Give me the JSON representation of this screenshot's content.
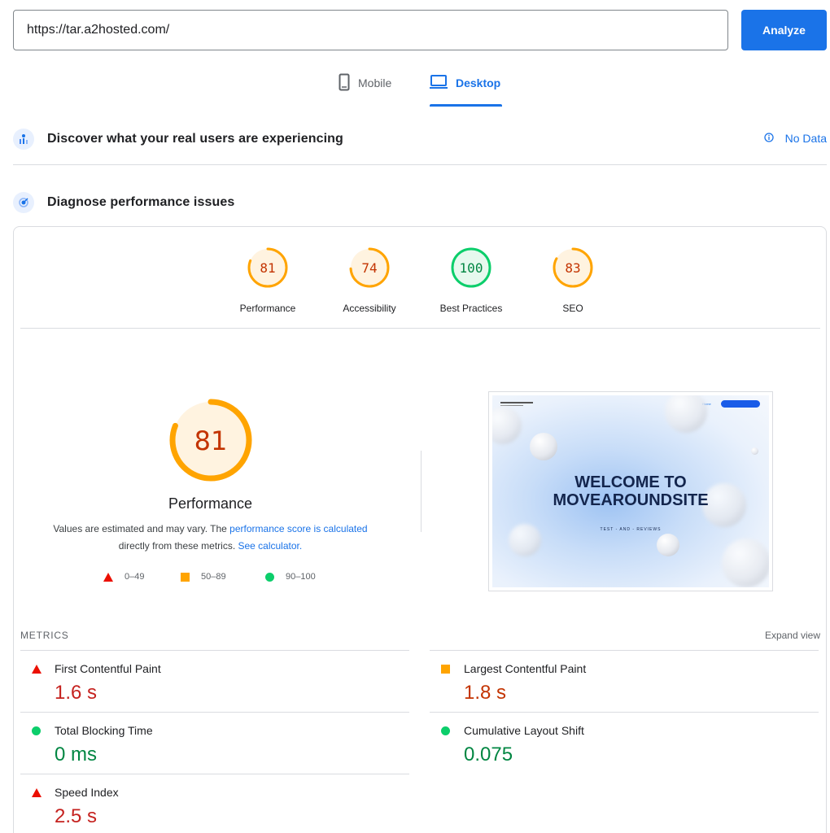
{
  "search": {
    "url_value": "https://tar.a2hosted.com/",
    "analyze_label": "Analyze"
  },
  "tabs": [
    {
      "label": "Mobile",
      "icon": "smartphone-icon",
      "active": false
    },
    {
      "label": "Desktop",
      "icon": "laptop-icon",
      "active": true
    }
  ],
  "field_data": {
    "title": "Discover what your real users are experiencing",
    "status": "No Data",
    "status_icon": "info-icon"
  },
  "lab_data": {
    "title": "Diagnose performance issues"
  },
  "categories": [
    {
      "label": "Performance",
      "score": "81",
      "color": "#ffa400",
      "text_color": "#c33300",
      "fill": "#fff3e0"
    },
    {
      "label": "Accessibility",
      "score": "74",
      "color": "#ffa400",
      "text_color": "#c33300",
      "fill": "#fff3e0"
    },
    {
      "label": "Best Practices",
      "score": "100",
      "color": "#0cce6b",
      "text_color": "#018642",
      "fill": "#e6f9ee"
    },
    {
      "label": "SEO",
      "score": "83",
      "color": "#ffa400",
      "text_color": "#c33300",
      "fill": "#fff3e0"
    }
  ],
  "performance": {
    "score": "81",
    "title": "Performance",
    "desc_prefix": "Values are estimated and may vary. The ",
    "desc_link1": "performance score is calculated",
    "desc_middle": " directly from these metrics. ",
    "desc_link2": "See calculator."
  },
  "legend": [
    {
      "range": "0–49",
      "shape": "triangle",
      "color": "#eb0f00"
    },
    {
      "range": "50–89",
      "shape": "square",
      "color": "#ffa400"
    },
    {
      "range": "90–100",
      "shape": "circle",
      "color": "#0cce6b"
    }
  ],
  "screenshot": {
    "heading_line1": "WELCOME TO",
    "heading_line2": "MOVEAROUNDSITE",
    "subtitle": "TEST - AND - REVIEWS",
    "nav_home": "Home"
  },
  "metrics_section": {
    "label": "METRICS",
    "expand_label": "Expand view"
  },
  "metrics": [
    {
      "name": "First Contentful Paint",
      "value": "1.6 s",
      "rating": "poor"
    },
    {
      "name": "Largest Contentful Paint",
      "value": "1.8 s",
      "rating": "average"
    },
    {
      "name": "Total Blocking Time",
      "value": "0 ms",
      "rating": "good"
    },
    {
      "name": "Cumulative Layout Shift",
      "value": "0.075",
      "rating": "good"
    },
    {
      "name": "Speed Index",
      "value": "2.5 s",
      "rating": "poor"
    }
  ]
}
